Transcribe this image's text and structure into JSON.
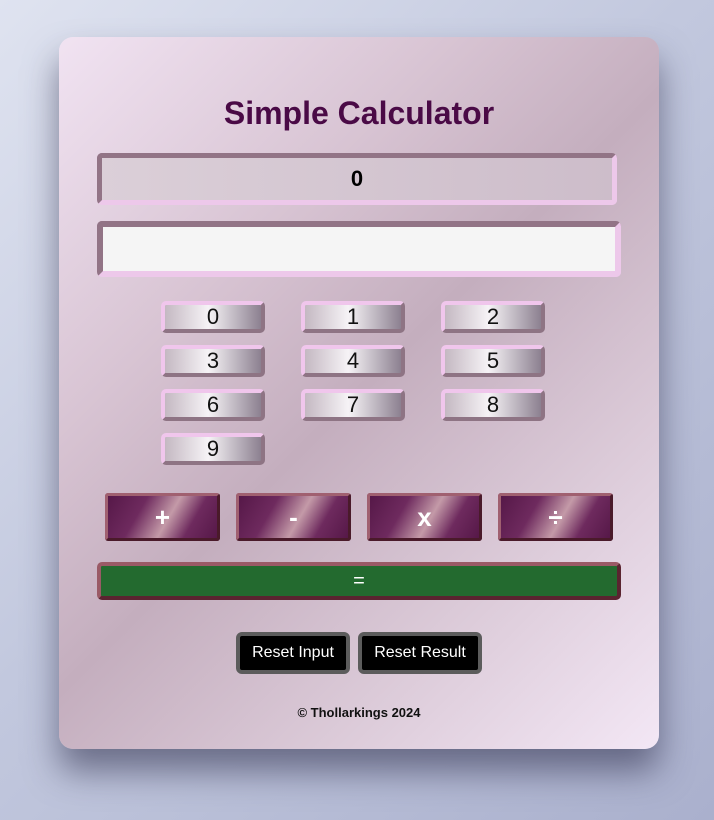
{
  "header": {
    "title": "Simple Calculator"
  },
  "display": {
    "result": "0",
    "input_value": "",
    "input_placeholder": ""
  },
  "digits": {
    "d0": "0",
    "d1": "1",
    "d2": "2",
    "d3": "3",
    "d4": "4",
    "d5": "5",
    "d6": "6",
    "d7": "7",
    "d8": "8",
    "d9": "9"
  },
  "operators": {
    "add": "+",
    "subtract": "-",
    "multiply": "x",
    "divide": "÷"
  },
  "equals_label": "=",
  "reset": {
    "input_label": "Reset Input",
    "result_label": "Reset Result"
  },
  "footer": {
    "text": "© Thollarkings 2024"
  },
  "colors": {
    "title": "#4a0a46",
    "operator_button": "#561848",
    "equals_button": "#236a2f",
    "reset_button": "#000000"
  }
}
